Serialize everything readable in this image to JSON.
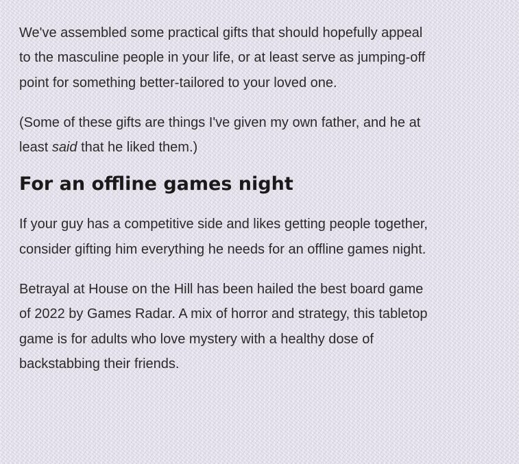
{
  "paragraphs": {
    "p1": "We've assembled some practical gifts that should hopefully appeal to the masculine people in your life, or at least serve as jumping-off point for something better-tailored to your loved one.",
    "p2_before": "(Some of these gifts are things I've given my own father, and he at least ",
    "p2_em": "said",
    "p2_after": " that he liked them.)"
  },
  "section": {
    "heading": "For an offline games night",
    "p3": "If your guy has a competitive side and likes getting people together, consider gifting him everything he needs for an offline games night.",
    "p4": "Betrayal at House on the Hill has been hailed the best board game of 2022 by Games Radar. A mix of horror and strategy, this tabletop game is for adults who love mystery with a healthy dose of backstabbing their friends."
  }
}
